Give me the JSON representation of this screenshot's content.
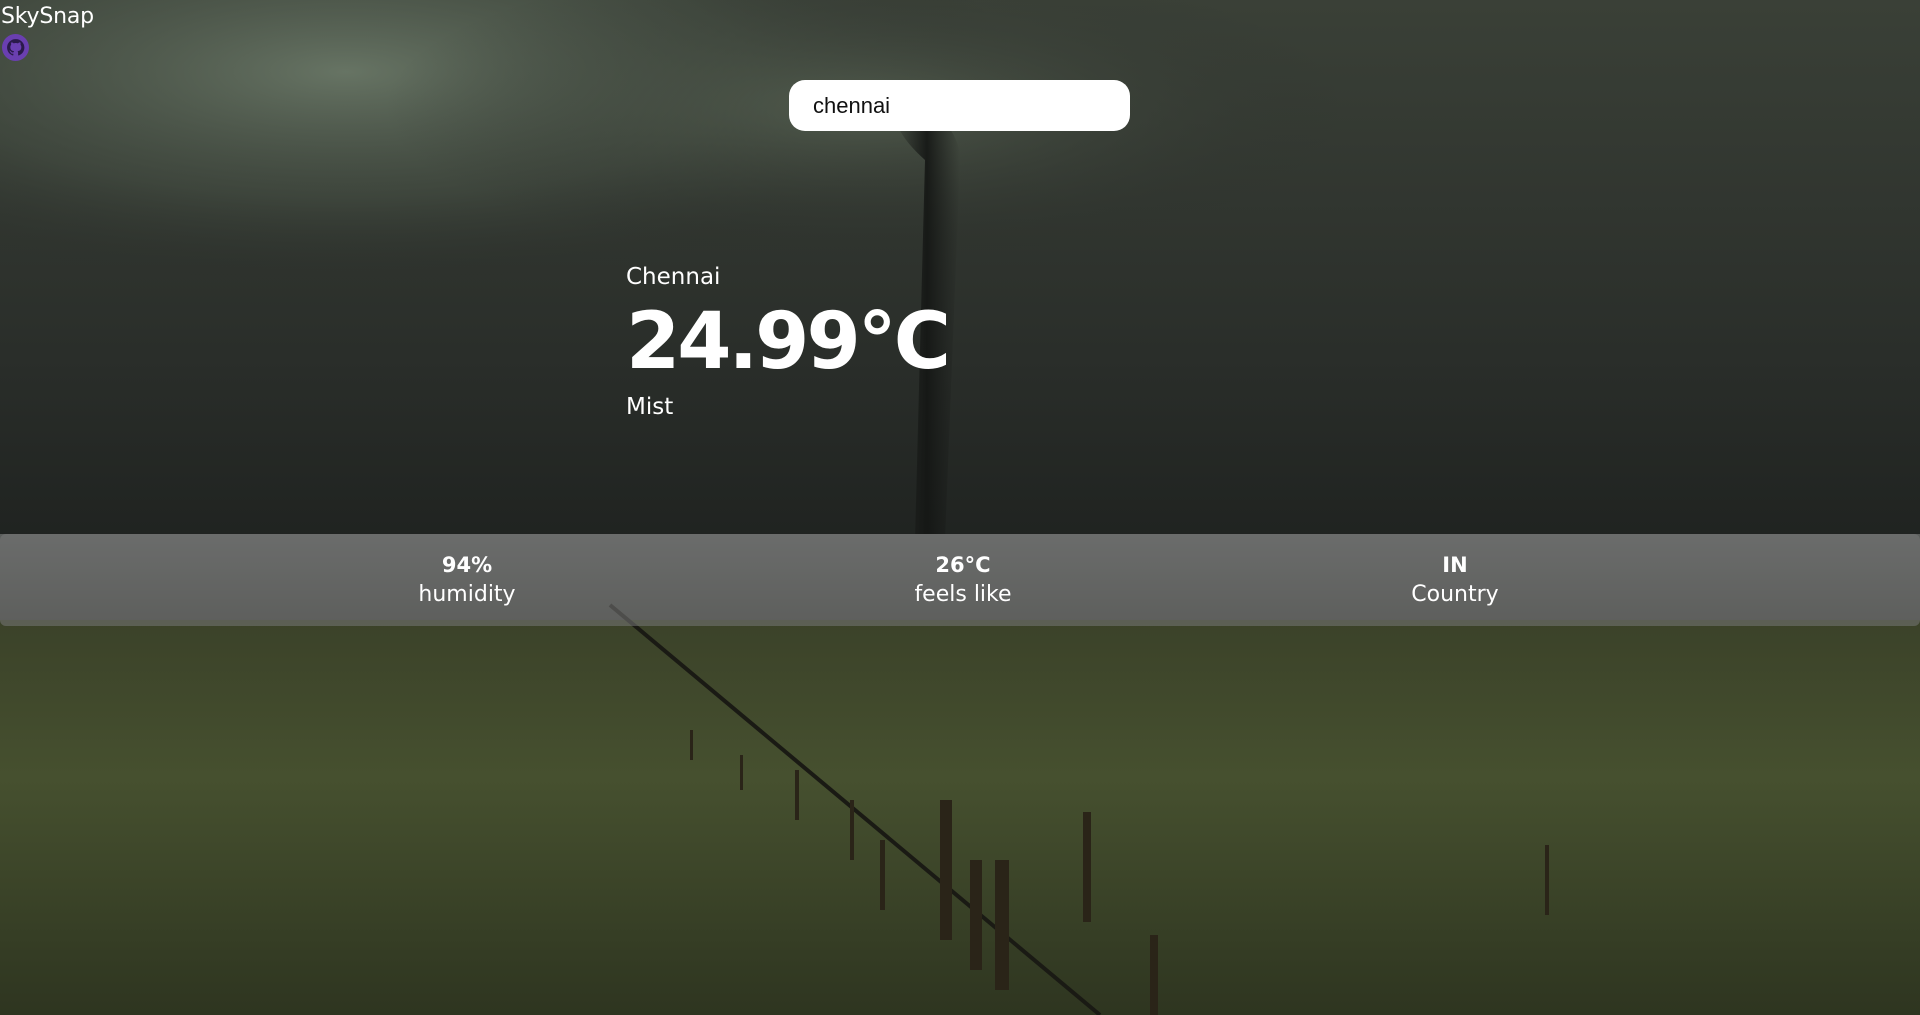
{
  "app": {
    "title": "SkySnap",
    "github_icon": "github-icon"
  },
  "search": {
    "value": "chennai",
    "placeholder": ""
  },
  "weather": {
    "city": "Chennai",
    "temperature": "24.99°C",
    "condition": "Mist"
  },
  "stats": {
    "humidity_value": "94%",
    "humidity_label": "humidity",
    "feels_like_value": "26°C",
    "feels_like_label": "feels like",
    "country_value": "IN",
    "country_label": "Country"
  },
  "colors": {
    "text": "#ffffff",
    "search_bg": "#ffffff",
    "stats_bar_bg": "rgba(120,120,120,0.55)",
    "github_icon": "#6a3fb0"
  }
}
